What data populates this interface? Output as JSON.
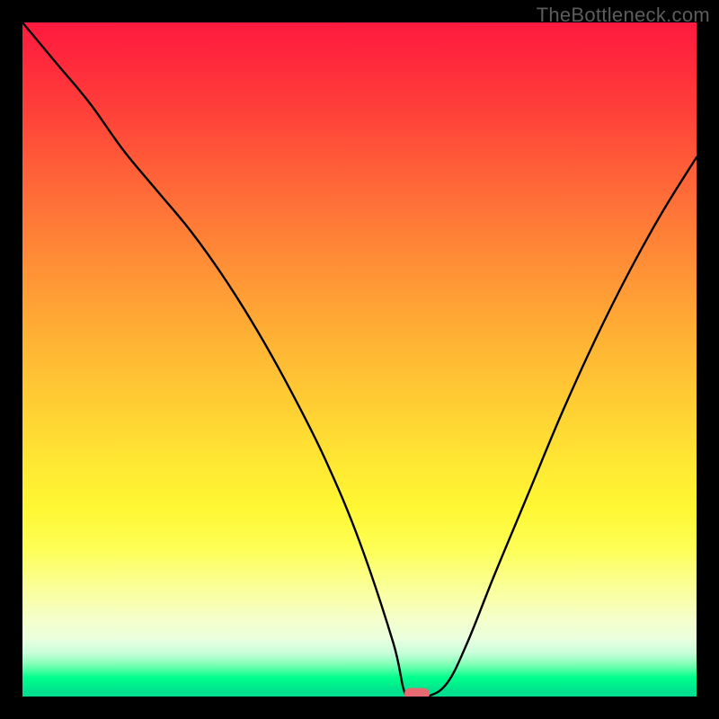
{
  "watermark": "TheBottleneck.com",
  "chart_data": {
    "type": "line",
    "title": "",
    "xlabel": "",
    "ylabel": "",
    "xlim": [
      0,
      100
    ],
    "ylim": [
      0,
      100
    ],
    "grid": false,
    "legend": false,
    "background_gradient": {
      "direction": "vertical",
      "stops": [
        {
          "pct": 0,
          "color": "#ff1a3f"
        },
        {
          "pct": 50,
          "color": "#ffc833"
        },
        {
          "pct": 80,
          "color": "#fbff66"
        },
        {
          "pct": 97,
          "color": "#00ff8d"
        },
        {
          "pct": 100,
          "color": "#00dd90"
        }
      ]
    },
    "series": [
      {
        "name": "bottleneck-curve",
        "color": "#000000",
        "x": [
          0,
          5,
          10,
          15,
          20,
          25,
          30,
          35,
          40,
          45,
          50,
          55,
          57,
          60,
          63,
          66,
          70,
          75,
          80,
          85,
          90,
          95,
          100
        ],
        "y": [
          100,
          94,
          88,
          81,
          75,
          69,
          62,
          54,
          45,
          35,
          23,
          8,
          0,
          0,
          2,
          8,
          18,
          30,
          42,
          53,
          63,
          72,
          80
        ]
      }
    ],
    "marker": {
      "name": "bottleneck-point",
      "x": 58.5,
      "y": 0,
      "color": "#e66a6f",
      "shape": "pill"
    }
  }
}
